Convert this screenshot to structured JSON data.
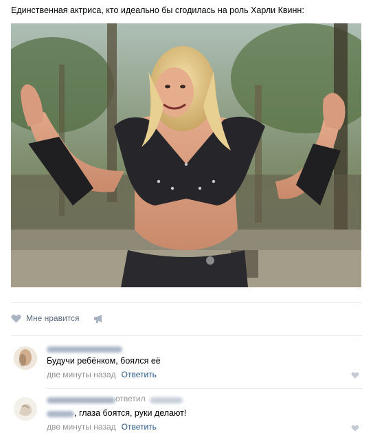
{
  "post": {
    "text": "Единственная актриса, кто идеально бы сгодилась на роль Харли Квинн:",
    "photo_alt": "photo"
  },
  "actions": {
    "like_label": "Мне нравится"
  },
  "comments": [
    {
      "text": "Будучи ребёнком, боялся её",
      "time": "две минуты назад",
      "reply_label": "Ответить"
    },
    {
      "replied_label": "ответил",
      "text": ", глаза боятся, руки делают!",
      "time": "две минуты назад",
      "reply_label": "Ответить"
    }
  ],
  "colors": {
    "link": "#2a5885",
    "meta": "#939393",
    "like": "#5a6a80",
    "icon": "#aab4c2",
    "separator": "#e7e8ec"
  }
}
